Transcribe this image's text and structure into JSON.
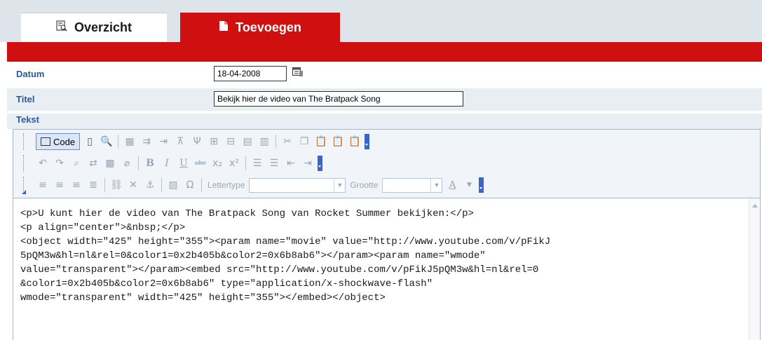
{
  "tabs": [
    {
      "label": "Overzicht",
      "icon": "search-list-icon",
      "active": false
    },
    {
      "label": "Toevoegen",
      "icon": "document-icon",
      "active": true
    }
  ],
  "form": {
    "datum": {
      "label": "Datum",
      "value": "18-04-2008",
      "icon": "calendar-icon"
    },
    "titel": {
      "label": "Titel",
      "value": "Bekijk hier de video van The Bratpack Song"
    },
    "tekst": {
      "label": "Tekst"
    }
  },
  "editor": {
    "code_button_label": "Code",
    "font_label": "Lettertype",
    "size_label": "Grootte",
    "code_lines": [
      "<p>U kunt hier de video van The Bratpack Song van Rocket Summer bekijken:</p>",
      "<p align=\"center\">&nbsp;</p>",
      "",
      "<object width=\"425\" height=\"355\"><param name=\"movie\" value=\"http://www.youtube.com/v/pFikJ",
      "5pQM3w&hl=nl&rel=0&color1=0x2b405b&color2=0x6b8ab6\"></param><param name=\"wmode\"",
      "value=\"transparent\"></param><embed src=\"http://www.youtube.com/v/pFikJ5pQM3w&hl=nl&rel=0",
      "&color1=0x2b405b&color2=0x6b8ab6\" type=\"application/x-shockwave-flash\"",
      "wmode=\"transparent\" width=\"425\" height=\"355\"></embed></object>"
    ]
  },
  "colors": {
    "accent": "#d01010",
    "label": "#2a5a9a",
    "row_alt": "#e9eef2"
  }
}
